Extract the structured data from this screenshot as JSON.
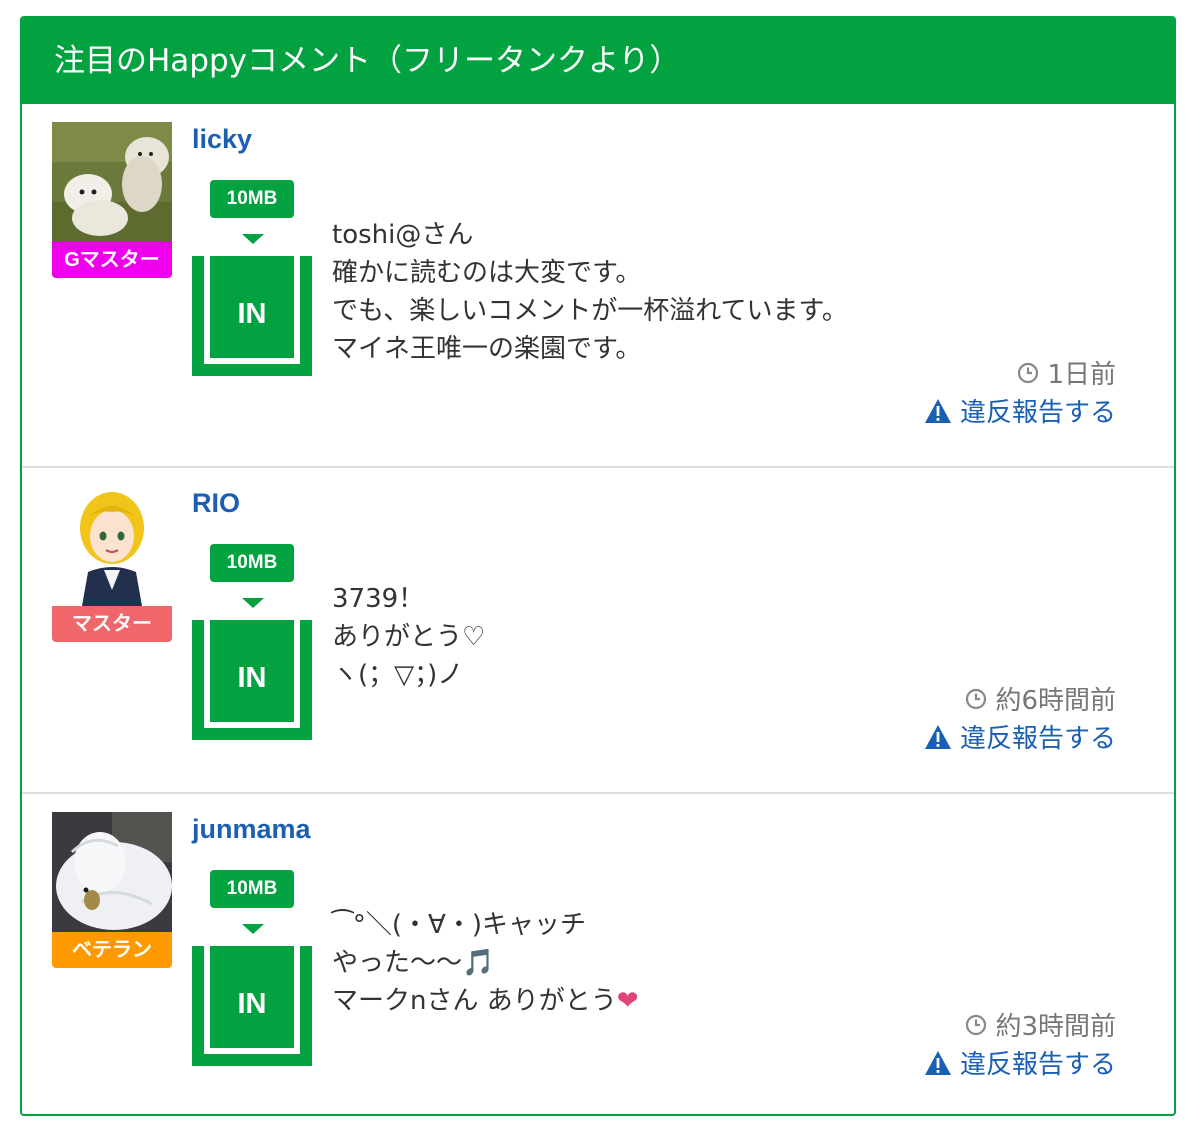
{
  "panel": {
    "title": "注目のHappyコメント（フリータンクより）",
    "accent_color": "#02a240"
  },
  "entries": [
    {
      "username": "licky",
      "rank": "Gマスター",
      "rank_color": "#ee00ee",
      "avatar": "two-white-dogs-photo",
      "capacity": "10MB",
      "action": "IN",
      "comment_lines": [
        "toshi@さん",
        "確かに読むのは大変です。",
        "でも、楽しいコメントが一杯溢れています。",
        "マイネ王唯一の楽園です。"
      ],
      "time": "1日前",
      "report": "違反報告する"
    },
    {
      "username": "RIO",
      "rank": "マスター",
      "rank_color": "#f0676b",
      "avatar": "blonde-character-illustration",
      "capacity": "10MB",
      "action": "IN",
      "comment_lines": [
        "3739！",
        "ありがとう♡",
        "ヽ(；▽；)ノ"
      ],
      "time": "約6時間前",
      "report": "違反報告する"
    },
    {
      "username": "junmama",
      "rank": "ベテラン",
      "rank_color": "#ff9900",
      "avatar": "white-swan-photo",
      "capacity": "10MB",
      "action": "IN",
      "comment_lines": [
        "⁀°＼(・∀・)キャッチ",
        "やった〜〜🎵",
        "マークnさん ありがとう"
      ],
      "comment_trailing_icon": "heart-icon",
      "time": "約3時間前",
      "report": "違反報告する"
    }
  ]
}
